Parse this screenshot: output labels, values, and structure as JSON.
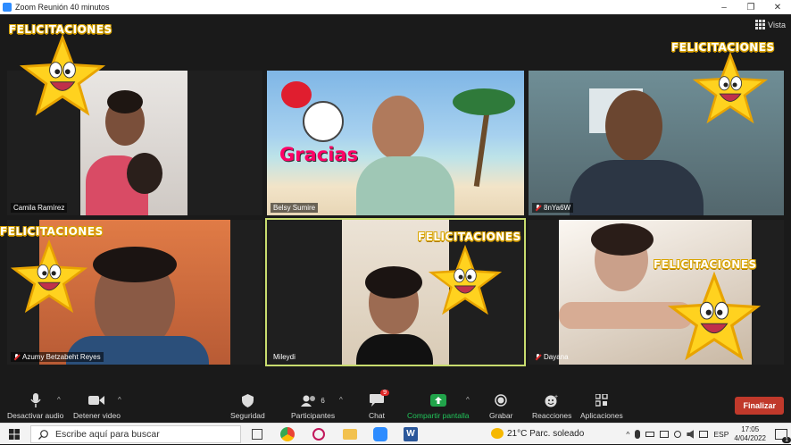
{
  "window": {
    "title": "Zoom Reunión 40 minutos",
    "minimize": "–",
    "maximize": "❐",
    "close": "✕"
  },
  "header": {
    "view_label": "Vista"
  },
  "sticker_text": "FELICITACIONES",
  "participants": [
    {
      "name": "Camila Ramírez",
      "muted": false
    },
    {
      "name": "Belsy Sumire",
      "muted": false
    },
    {
      "name": "8nYa6W",
      "muted": true
    },
    {
      "name": "Azumy Betzabeht Reyes",
      "muted": true
    },
    {
      "name": "Mileydi",
      "muted": false,
      "active_speaker": true
    },
    {
      "name": "Dayana",
      "muted": true
    }
  ],
  "background_text": "Gracias",
  "toolbar": {
    "mute_label": "Desactivar audio",
    "video_label": "Detener video",
    "security_label": "Seguridad",
    "participants_label": "Participantes",
    "participants_count": "6",
    "chat_label": "Chat",
    "chat_badge": "9",
    "share_label": "Compartir pantalla",
    "record_label": "Grabar",
    "reactions_label": "Reacciones",
    "apps_label": "Aplicaciones",
    "end_label": "Finalizar"
  },
  "taskbar": {
    "search_placeholder": "Escribe aquí para buscar",
    "weather": "21°C  Parc. soleado",
    "language": "ESP",
    "time": "17:05",
    "date": "4/04/2022",
    "notifications": "1"
  },
  "colors": {
    "share_green": "#21a34a",
    "end_red": "#c0392b",
    "active_border": "#c8dc6e",
    "zoom_blue": "#2D8CFF"
  }
}
